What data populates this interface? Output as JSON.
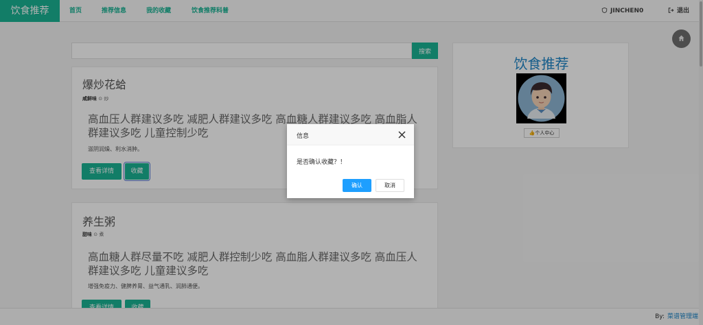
{
  "navbar": {
    "brand": "饮食推荐",
    "links": [
      "首页",
      "推荐信息",
      "我的收藏",
      "饮食推荐科普"
    ],
    "user": "JINCHEN0",
    "logout": "退出"
  },
  "search": {
    "button": "搜索",
    "value": ""
  },
  "cards": [
    {
      "title": "爆炒花蛤",
      "taste": "咸鲜味",
      "method": "炒",
      "tags": "高血压人群建议多吃 减肥人群建议多吃 高血糖人群建议多吃 高血脂人群建议多吃 儿童控制少吃",
      "desc": "滋阴润燥、利水消肿。",
      "detail_btn": "查看详情",
      "fav_btn": "收藏"
    },
    {
      "title": "养生粥",
      "taste": "甜味",
      "method": "煮",
      "tags": "高血糖人群尽量不吃 减肥人群控制少吃 高血脂人群建议多吃 高血压人群建议多吃 儿童建议多吃",
      "desc": "增强免疫力、健脾养胃、益气通乳、润肺通便。",
      "detail_btn": "查看详情",
      "fav_btn": "收藏"
    }
  ],
  "profile": {
    "title": "饮食推荐",
    "button": "个人中心"
  },
  "footer": {
    "by": "By:",
    "link": "菜谱管理端"
  },
  "modal": {
    "title": "信息",
    "message": "是否确认收藏？！",
    "confirm": "确认",
    "cancel": "取消"
  },
  "colors": {
    "accent": "#1ab394",
    "primary_button": "#1e9fff",
    "profile_title": "#1f86c7"
  }
}
